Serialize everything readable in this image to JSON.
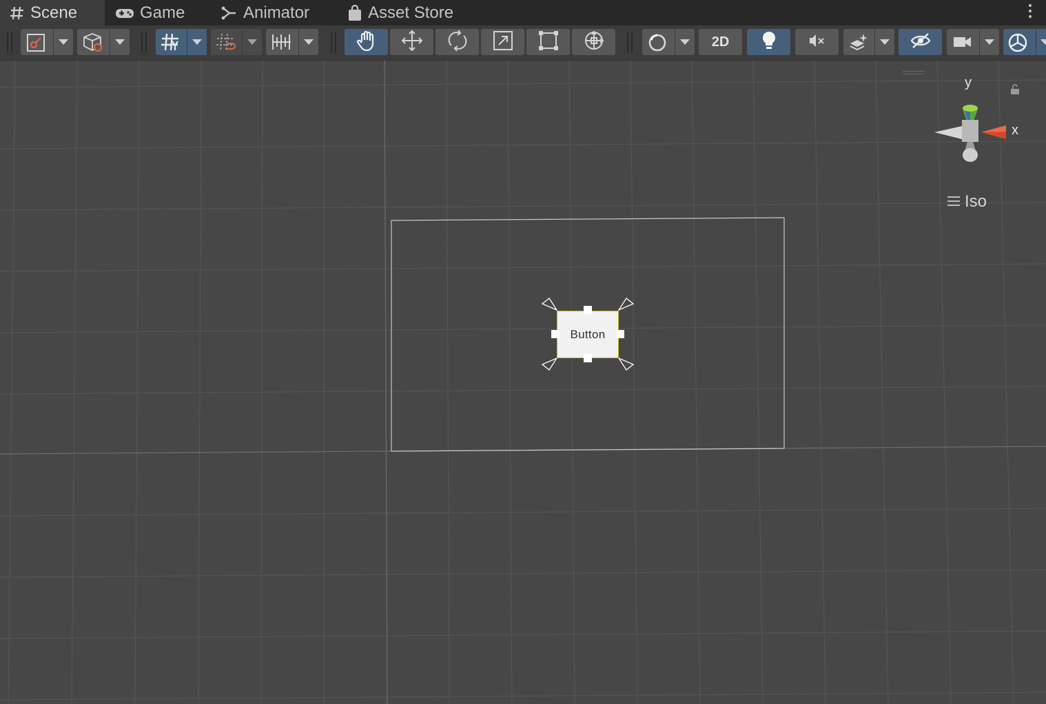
{
  "tabs": [
    {
      "label": "Scene",
      "icon": "hash-icon",
      "active": true
    },
    {
      "label": "Game",
      "icon": "gamepad-icon",
      "active": false
    },
    {
      "label": "Animator",
      "icon": "animator-icon",
      "active": false
    },
    {
      "label": "Asset Store",
      "icon": "shopping-bag-icon",
      "active": false
    }
  ],
  "toolbar": {
    "mode_2d_label": "2D",
    "tools": [
      "view-tool",
      "move-tool",
      "rotate-tool",
      "scale-tool",
      "rect-tool",
      "transform-tool"
    ],
    "active_tool": "view-tool",
    "active_color": "#46607c"
  },
  "scene": {
    "selected_button_label": "Button",
    "selection_outline_color": "#c8b61c",
    "gizmo": {
      "y_label": "y",
      "x_label": "x",
      "projection_label": "Iso",
      "y_color": "#8ac43f",
      "x_color": "#d9472a"
    }
  }
}
